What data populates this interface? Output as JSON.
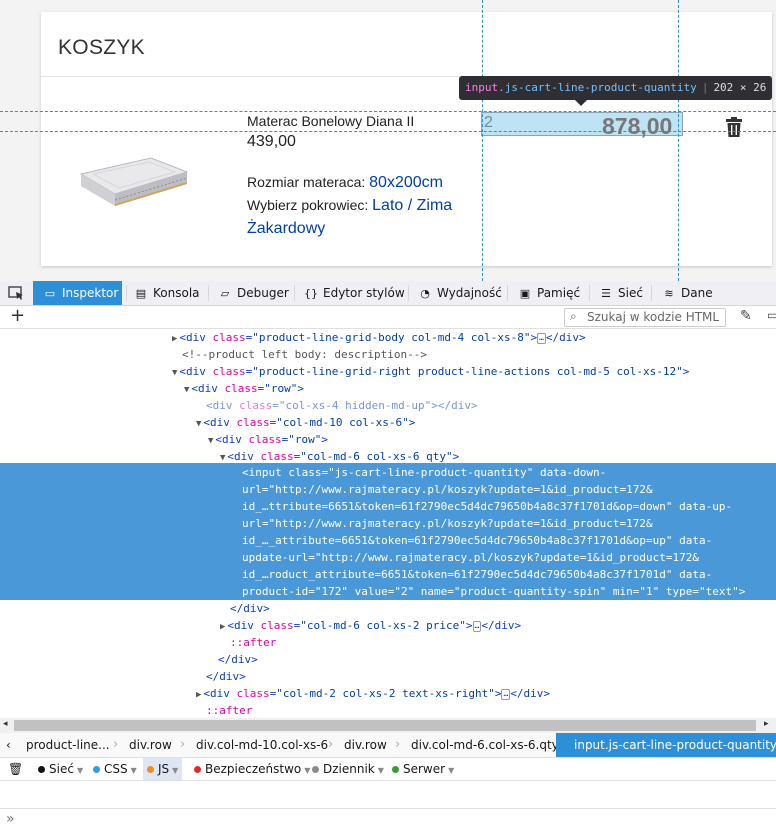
{
  "page": {
    "cart_title": "KOSZYK",
    "product": {
      "name": "Materac Bonelowy Diana II",
      "price": "439,00",
      "attributes": [
        {
          "label": "Rozmiar materaca:",
          "value": "80x200cm"
        },
        {
          "label": "Wybierz pokrowiec:",
          "value": "Lato / Zima Żakardowy"
        }
      ],
      "quantity": "2",
      "line_total": "878,00"
    },
    "tooltip": {
      "tag": "input",
      "cls": ".js-cart-line-product-quantity",
      "size": "202 × 26"
    }
  },
  "devtools": {
    "tabs": [
      {
        "label": "Inspektor",
        "icon": "inspector-icon",
        "selected": true
      },
      {
        "label": "Konsola",
        "icon": "console-icon"
      },
      {
        "label": "Debuger",
        "icon": "debugger-icon"
      },
      {
        "label": "Edytor stylów",
        "icon": "style-editor-icon"
      },
      {
        "label": "Wydajność",
        "icon": "performance-icon"
      },
      {
        "label": "Pamięć",
        "icon": "memory-icon"
      },
      {
        "label": "Sieć",
        "icon": "network-icon"
      },
      {
        "label": "Dane",
        "icon": "storage-icon"
      }
    ],
    "search_placeholder": "Szukaj w kodzie HTML",
    "html_tree": [
      {
        "indent": 0,
        "twisty": "closed",
        "tag": "div",
        "cls": "product-line-grid-body col-md-4 col-xs-8",
        "collapsed": true
      },
      {
        "indent": 0,
        "comment": "<!--product left body: description-->"
      },
      {
        "indent": 0,
        "twisty": "open",
        "tag": "div",
        "cls": "product-line-grid-right product-line-actions col-md-5 col-xs-12"
      },
      {
        "indent": 1,
        "twisty": "open",
        "tag": "div",
        "cls": "row"
      },
      {
        "indent": 2,
        "tag": "div",
        "cls": "col-xs-4 hidden-md-up",
        "empty": true,
        "dim": true
      },
      {
        "indent": 2,
        "twisty": "open",
        "tag": "div",
        "cls": "col-md-10 col-xs-6"
      },
      {
        "indent": 3,
        "twisty": "open",
        "tag": "div",
        "cls": "row"
      },
      {
        "indent": 4,
        "twisty": "open",
        "tag": "div",
        "cls": "col-md-6 col-xs-6 qty"
      }
    ],
    "selected_node_lines": [
      "<input class=\"js-cart-line-product-quantity\" data-down-",
      "url=\"http://www.rajmateracy.pl/koszyk?update=1&id_product=172&",
      "id_…ttribute=6651&token=61f2790ec5d4dc79650b4a8c37f1701d&op=down\" data-up-",
      "url=\"http://www.rajmateracy.pl/koszyk?update=1&id_product=172&",
      "id_…_attribute=6651&token=61f2790ec5d4dc79650b4a8c37f1701d&op=up\" data-",
      "update-url=\"http://www.rajmateracy.pl/koszyk?update=1&id_product=172&",
      "id_…roduct_attribute=6651&token=61f2790ec5d4dc79650b4a8c37f1701d\" data-",
      "product-id=\"172\" value=\"2\" name=\"product-quantity-spin\" min=\"1\" type=\"text\">"
    ],
    "html_tree_after": [
      {
        "indent": 4,
        "close": "</div>"
      },
      {
        "indent": 4,
        "twisty": "closed",
        "tag": "div",
        "cls": "col-md-6 col-xs-2 price",
        "collapsed": true
      },
      {
        "indent": 4,
        "pseudo": "::after"
      },
      {
        "indent": 3,
        "close": "</div>"
      },
      {
        "indent": 2,
        "close": "</div>"
      },
      {
        "indent": 2,
        "twisty": "closed",
        "tag": "div",
        "cls": "col-md-2 col-xs-2 text-xs-right",
        "collapsed": true
      },
      {
        "indent": 2,
        "pseudo": "::after"
      }
    ],
    "breadcrumbs": [
      "product-line...",
      "div.row",
      "div.col-md-10.col-xs-6",
      "div.row",
      "div.col-md-6.col-xs-6.qty",
      "input.js-cart-line-product-quantity"
    ],
    "console_filters": [
      {
        "label": "Sieć",
        "color": "#111111"
      },
      {
        "label": "CSS",
        "color": "#2aa0e0"
      },
      {
        "label": "JS",
        "color": "#f08a24",
        "active": true
      },
      {
        "label": "Bezpieczeństwo",
        "color": "#e0292f"
      },
      {
        "label": "Dziennik",
        "color": "#8a8a8a"
      },
      {
        "label": "Serwer",
        "color": "#3a9a3a"
      }
    ],
    "prompt": "»"
  }
}
